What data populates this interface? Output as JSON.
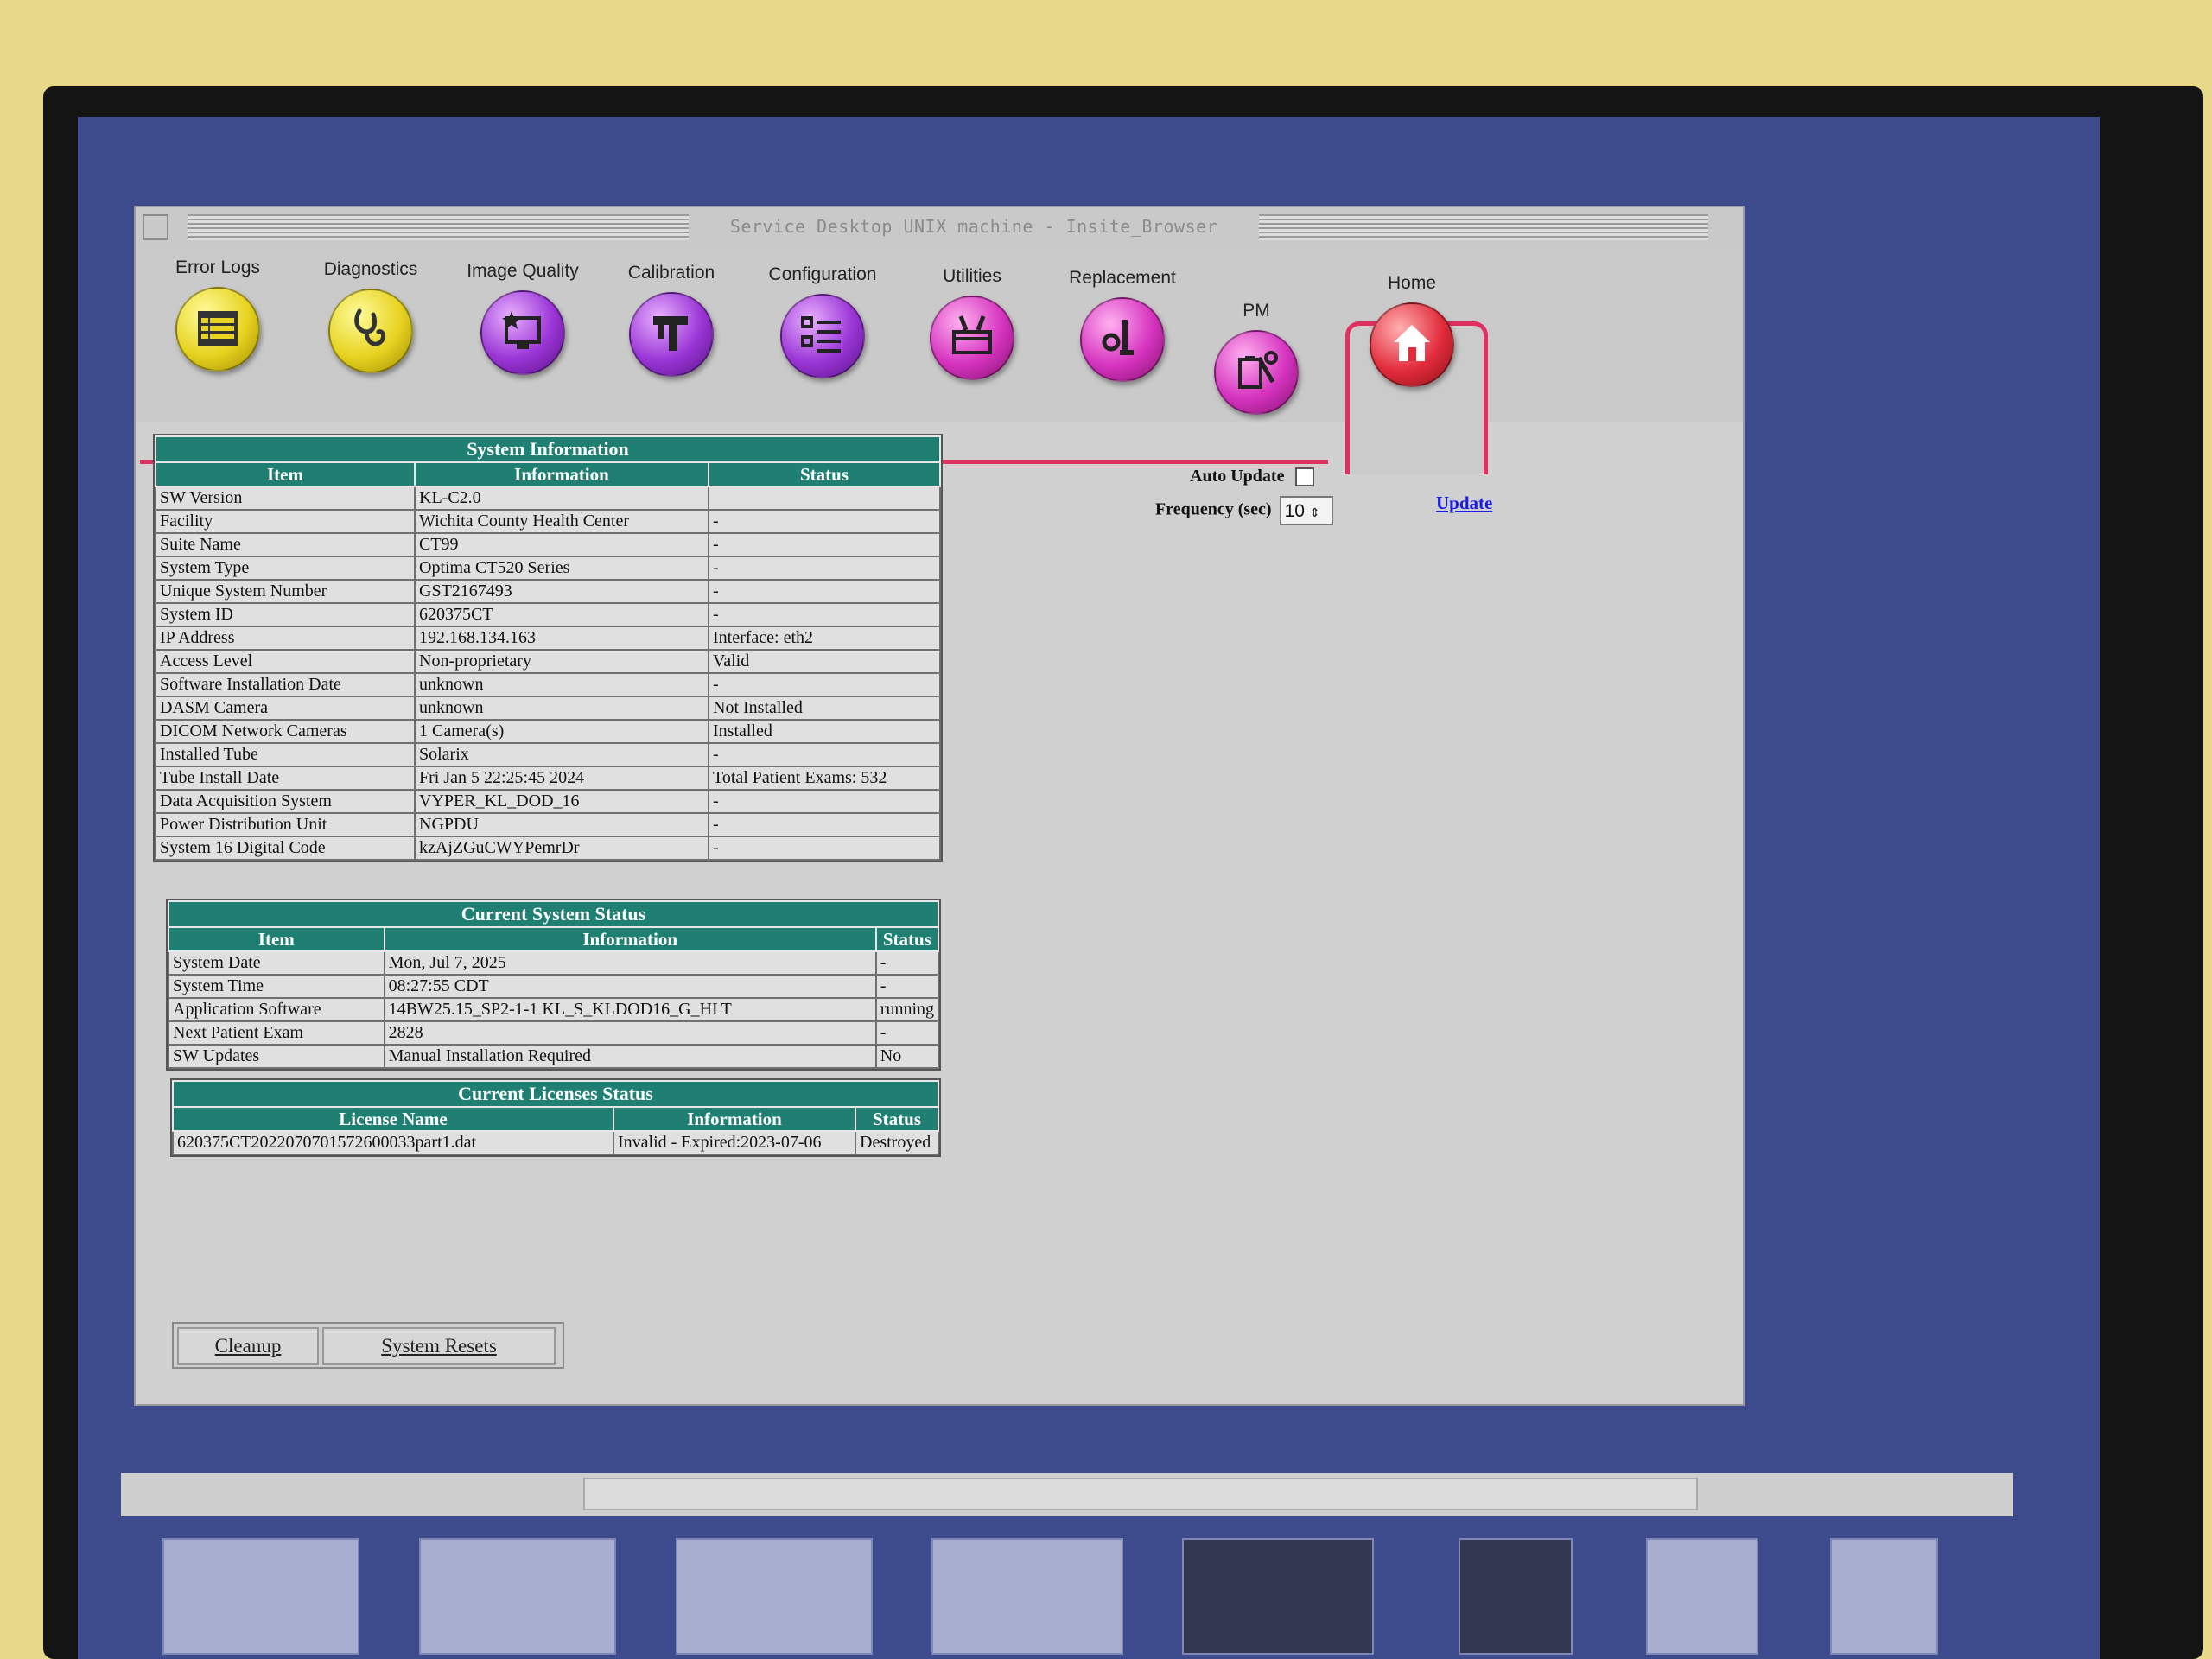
{
  "window": {
    "title": "Service Desktop UNIX machine - Insite_Browser",
    "min_icon": "minimize-icon",
    "max_icon": "maximize-icon",
    "close_icon": "close-icon"
  },
  "toolbar": {
    "items": [
      {
        "label": "Error Logs",
        "icon": "log-table-icon",
        "color": "#e7d320"
      },
      {
        "label": "Diagnostics",
        "icon": "stethoscope-icon",
        "color": "#e7d320"
      },
      {
        "label": "Image Quality",
        "icon": "monitor-star-icon",
        "color": "#9a35d6"
      },
      {
        "label": "Calibration",
        "icon": "caliper-icon",
        "color": "#9a35d6"
      },
      {
        "label": "Configuration",
        "icon": "checklist-icon",
        "color": "#9a35d6"
      },
      {
        "label": "Utilities",
        "icon": "toolbox-icon",
        "color": "#d533bf"
      },
      {
        "label": "Replacement",
        "icon": "wrench-bolt-icon",
        "color": "#d533bf"
      },
      {
        "label": "PM",
        "icon": "clipboard-wrench-icon",
        "color": "#d533bf"
      },
      {
        "label": "Home",
        "icon": "home-icon",
        "color": "#e22c3c",
        "active": true
      }
    ]
  },
  "system_info": {
    "caption": "System Information",
    "headers": [
      "Item",
      "Information",
      "Status"
    ],
    "rows": [
      [
        "SW Version",
        "KL-C2.0",
        ""
      ],
      [
        "Facility",
        "Wichita County Health Center",
        "-"
      ],
      [
        "Suite Name",
        "CT99",
        "-"
      ],
      [
        "System Type",
        "Optima CT520 Series",
        "-"
      ],
      [
        "Unique System Number",
        "GST2167493",
        "-"
      ],
      [
        "System ID",
        "620375CT",
        "-"
      ],
      [
        "IP Address",
        "192.168.134.163",
        "Interface: eth2"
      ],
      [
        "Access Level",
        "Non-proprietary",
        "Valid"
      ],
      [
        "Software Installation Date",
        "unknown",
        "-"
      ],
      [
        "DASM Camera",
        "unknown",
        "Not Installed"
      ],
      [
        "DICOM Network Cameras",
        "1 Camera(s)",
        "Installed"
      ],
      [
        "Installed Tube",
        "Solarix",
        "-"
      ],
      [
        "Tube Install Date",
        "Fri Jan 5 22:25:45 2024",
        "Total Patient Exams: 532"
      ],
      [
        "Data Acquisition System",
        "VYPER_KL_DOD_16",
        "-"
      ],
      [
        "Power Distribution Unit",
        "NGPDU",
        "-"
      ],
      [
        "System 16 Digital Code",
        "kzAjZGuCWYPemrDr",
        "-"
      ]
    ]
  },
  "current_status": {
    "caption": "Current System Status",
    "headers": [
      "Item",
      "Information",
      "Status"
    ],
    "rows": [
      [
        "System Date",
        "Mon, Jul 7, 2025",
        "-"
      ],
      [
        "System Time",
        "08:27:55 CDT",
        "-"
      ],
      [
        "Application Software",
        "14BW25.15_SP2-1-1 KL_S_KLDOD16_G_HLT",
        "running"
      ],
      [
        "Next Patient Exam",
        "2828",
        "-"
      ],
      [
        "SW Updates",
        "Manual Installation Required",
        "No"
      ]
    ]
  },
  "licenses": {
    "caption": "Current Licenses Status",
    "headers": [
      "License Name",
      "Information",
      "Status"
    ],
    "rows": [
      [
        "620375CT2022070701572600033part1.dat",
        "Invalid - Expired:2023-07-06",
        "Destroyed"
      ]
    ]
  },
  "controls": {
    "auto_update_label": "Auto Update",
    "auto_update_checked": false,
    "frequency_label": "Frequency (sec)",
    "frequency_value": "10",
    "update_link": "Update"
  },
  "buttons": {
    "cleanup": "Cleanup",
    "system_resets": "System Resets"
  },
  "taskbar": {
    "items": [
      {
        "icon": "patient-schedule-icon"
      },
      {
        "icon": "patient-transport-icon"
      },
      {
        "icon": "clock-worklist-icon"
      },
      {
        "icon": "scan-anatomy-icon"
      },
      {
        "icon": "image-viewer-icon"
      },
      {
        "icon": "image-stack-icon"
      },
      {
        "icon": "tube-icon"
      },
      {
        "icon": "gantry-service-icon"
      }
    ]
  }
}
